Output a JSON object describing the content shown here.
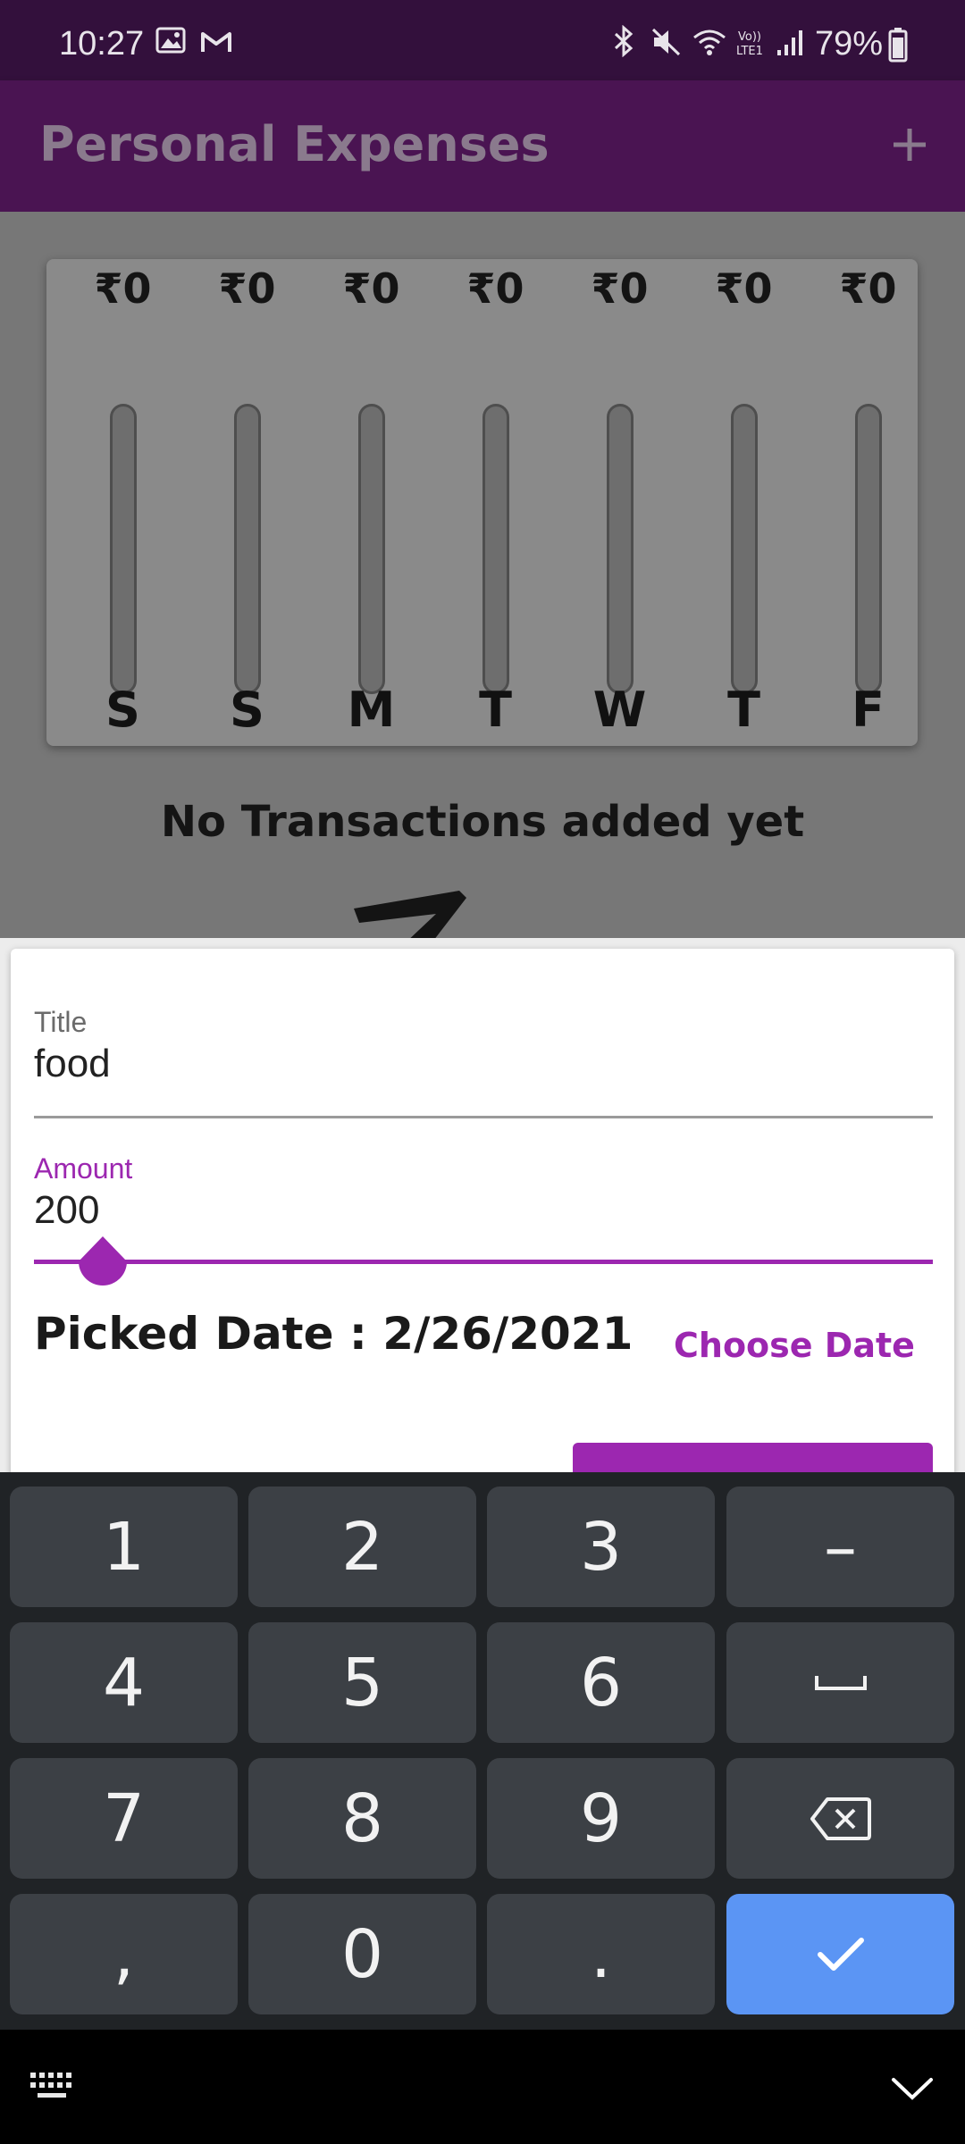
{
  "status_bar": {
    "time": "10:27",
    "battery_percent": "79%",
    "icons": [
      "image-icon",
      "gmail-icon",
      "bluetooth-icon",
      "mute-icon",
      "wifi-icon",
      "volte-icon",
      "signal-icon",
      "battery-icon"
    ]
  },
  "app_bar": {
    "title": "Personal Expenses",
    "add_icon": "plus-icon"
  },
  "chart": {
    "bars": [
      {
        "day": "S",
        "amount": "₹0",
        "fill_fraction": 0
      },
      {
        "day": "S",
        "amount": "₹0",
        "fill_fraction": 0
      },
      {
        "day": "M",
        "amount": "₹0",
        "fill_fraction": 0
      },
      {
        "day": "T",
        "amount": "₹0",
        "fill_fraction": 0
      },
      {
        "day": "W",
        "amount": "₹0",
        "fill_fraction": 0
      },
      {
        "day": "T",
        "amount": "₹0",
        "fill_fraction": 0
      },
      {
        "day": "F",
        "amount": "₹0",
        "fill_fraction": 0
      }
    ]
  },
  "main": {
    "empty_text": "No Transactions added yet"
  },
  "form": {
    "title_label": "Title",
    "title_value": "food",
    "amount_label": "Amount",
    "amount_value": "200",
    "picked_date": "Picked Date : 2/26/2021",
    "choose_date_label": "Choose Date"
  },
  "colors": {
    "accent": "#9c27b0",
    "app_bar": "#4a1452",
    "status_bar": "#33103c",
    "keyboard_bg": "#202326",
    "key_bg": "#3c4045",
    "done_key": "#5b95f4"
  },
  "keyboard": {
    "rows": [
      [
        "1",
        "2",
        "3",
        "–"
      ],
      [
        "4",
        "5",
        "6",
        "space"
      ],
      [
        "7",
        "8",
        "9",
        "backspace"
      ],
      [
        ",",
        "0",
        ".",
        "done"
      ]
    ],
    "keys": {
      "k1": "1",
      "k2": "2",
      "k3": "3",
      "minus": "–",
      "k4": "4",
      "k5": "5",
      "k6": "6",
      "k7": "7",
      "k8": "8",
      "k9": "9",
      "comma": ",",
      "k0": "0",
      "period": "."
    }
  },
  "navbar": {
    "icons": [
      "keyboard-switch-icon",
      "hide-keyboard-icon"
    ]
  }
}
